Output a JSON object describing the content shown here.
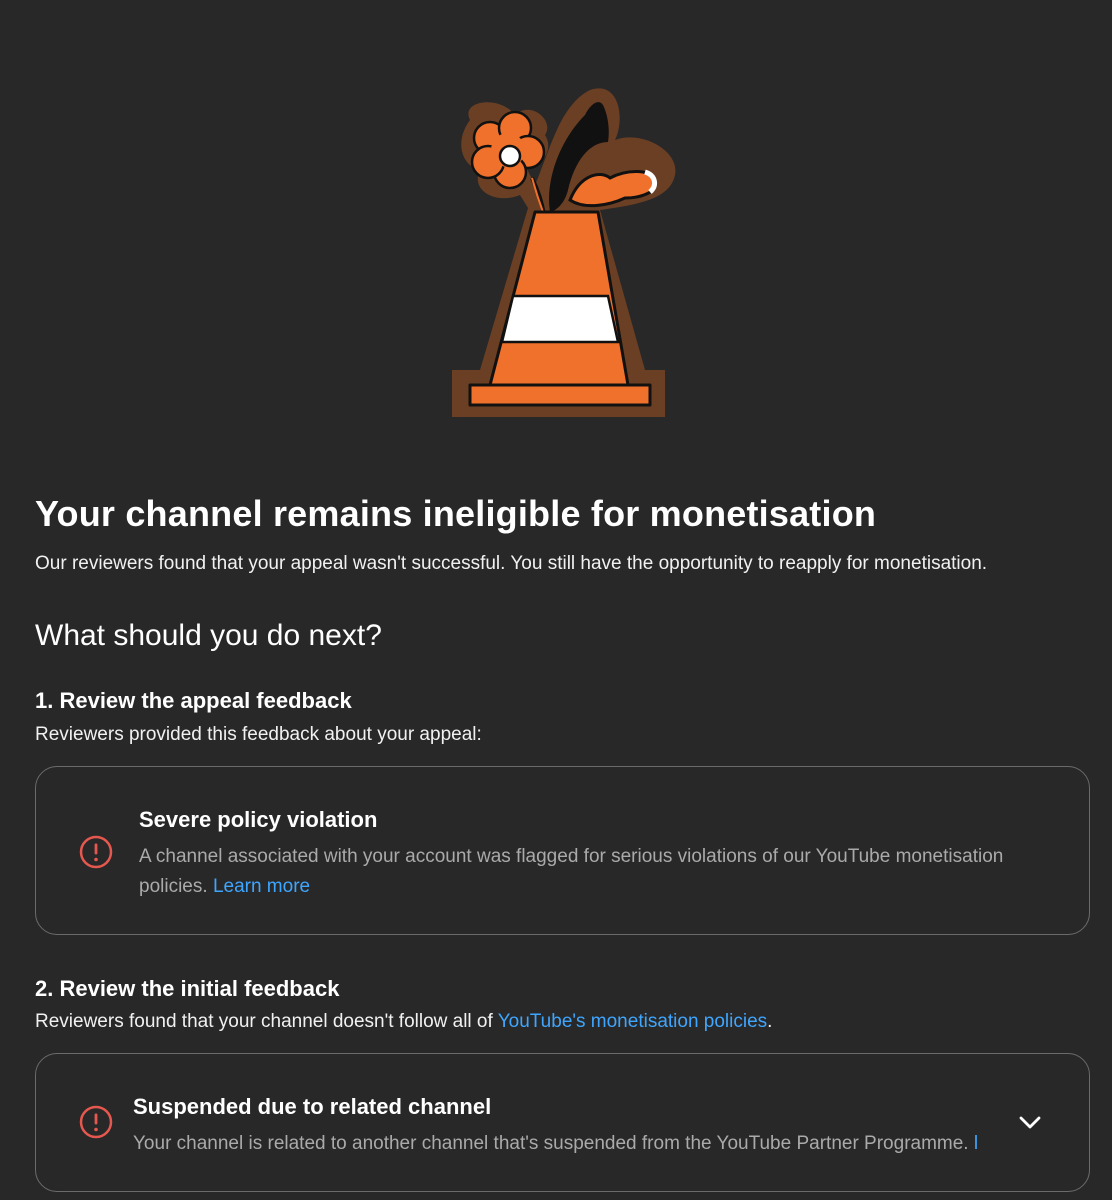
{
  "illustration": {
    "icon": "traffic-cone-with-flower-illustration"
  },
  "header": {
    "title": "Your channel remains ineligible for monetisation",
    "subtitle": "Our reviewers found that your appeal wasn't successful. You still have the opportunity to reapply for monetisation."
  },
  "next_steps": {
    "heading": "What should you do next?",
    "step1": {
      "title": "1. Review the appeal feedback",
      "description": "Reviewers provided this feedback about your appeal:",
      "card": {
        "icon": "alert-circle-icon",
        "title": "Severe policy violation",
        "body": "A channel associated with your account was flagged for serious violations of our YouTube monetisation policies.",
        "link": "Learn more"
      }
    },
    "step2": {
      "title": "2. Review the initial feedback",
      "description_prefix": "Reviewers found that your channel doesn't follow all of ",
      "description_link": "YouTube's monetisation policies",
      "description_suffix": ".",
      "card": {
        "icon": "alert-circle-icon",
        "title": "Suspended due to related channel",
        "body": "Your channel is related to another channel that's suspended from the YouTube Partner Programme.",
        "link_fragment": "l",
        "expand_icon": "chevron-down-icon"
      }
    }
  },
  "colors": {
    "background": "#282828",
    "link": "#3ea6ff",
    "alert": "#e5584f",
    "card_border": "#6b6b6b",
    "cone_orange": "#ef712b",
    "cone_outline": "#6b3f24"
  }
}
